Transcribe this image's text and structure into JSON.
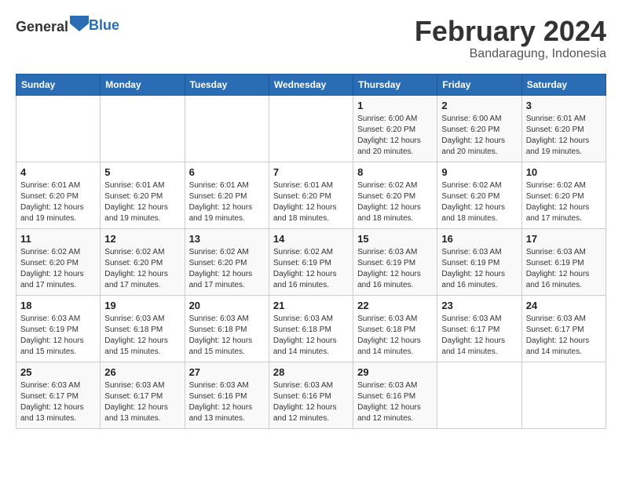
{
  "header": {
    "logo_general": "General",
    "logo_blue": "Blue",
    "month_title": "February 2024",
    "location": "Bandaragung, Indonesia"
  },
  "weekdays": [
    "Sunday",
    "Monday",
    "Tuesday",
    "Wednesday",
    "Thursday",
    "Friday",
    "Saturday"
  ],
  "weeks": [
    [
      {
        "day": "",
        "info": ""
      },
      {
        "day": "",
        "info": ""
      },
      {
        "day": "",
        "info": ""
      },
      {
        "day": "",
        "info": ""
      },
      {
        "day": "1",
        "info": "Sunrise: 6:00 AM\nSunset: 6:20 PM\nDaylight: 12 hours\nand 20 minutes."
      },
      {
        "day": "2",
        "info": "Sunrise: 6:00 AM\nSunset: 6:20 PM\nDaylight: 12 hours\nand 20 minutes."
      },
      {
        "day": "3",
        "info": "Sunrise: 6:01 AM\nSunset: 6:20 PM\nDaylight: 12 hours\nand 19 minutes."
      }
    ],
    [
      {
        "day": "4",
        "info": "Sunrise: 6:01 AM\nSunset: 6:20 PM\nDaylight: 12 hours\nand 19 minutes."
      },
      {
        "day": "5",
        "info": "Sunrise: 6:01 AM\nSunset: 6:20 PM\nDaylight: 12 hours\nand 19 minutes."
      },
      {
        "day": "6",
        "info": "Sunrise: 6:01 AM\nSunset: 6:20 PM\nDaylight: 12 hours\nand 19 minutes."
      },
      {
        "day": "7",
        "info": "Sunrise: 6:01 AM\nSunset: 6:20 PM\nDaylight: 12 hours\nand 18 minutes."
      },
      {
        "day": "8",
        "info": "Sunrise: 6:02 AM\nSunset: 6:20 PM\nDaylight: 12 hours\nand 18 minutes."
      },
      {
        "day": "9",
        "info": "Sunrise: 6:02 AM\nSunset: 6:20 PM\nDaylight: 12 hours\nand 18 minutes."
      },
      {
        "day": "10",
        "info": "Sunrise: 6:02 AM\nSunset: 6:20 PM\nDaylight: 12 hours\nand 17 minutes."
      }
    ],
    [
      {
        "day": "11",
        "info": "Sunrise: 6:02 AM\nSunset: 6:20 PM\nDaylight: 12 hours\nand 17 minutes."
      },
      {
        "day": "12",
        "info": "Sunrise: 6:02 AM\nSunset: 6:20 PM\nDaylight: 12 hours\nand 17 minutes."
      },
      {
        "day": "13",
        "info": "Sunrise: 6:02 AM\nSunset: 6:20 PM\nDaylight: 12 hours\nand 17 minutes."
      },
      {
        "day": "14",
        "info": "Sunrise: 6:02 AM\nSunset: 6:19 PM\nDaylight: 12 hours\nand 16 minutes."
      },
      {
        "day": "15",
        "info": "Sunrise: 6:03 AM\nSunset: 6:19 PM\nDaylight: 12 hours\nand 16 minutes."
      },
      {
        "day": "16",
        "info": "Sunrise: 6:03 AM\nSunset: 6:19 PM\nDaylight: 12 hours\nand 16 minutes."
      },
      {
        "day": "17",
        "info": "Sunrise: 6:03 AM\nSunset: 6:19 PM\nDaylight: 12 hours\nand 16 minutes."
      }
    ],
    [
      {
        "day": "18",
        "info": "Sunrise: 6:03 AM\nSunset: 6:19 PM\nDaylight: 12 hours\nand 15 minutes."
      },
      {
        "day": "19",
        "info": "Sunrise: 6:03 AM\nSunset: 6:18 PM\nDaylight: 12 hours\nand 15 minutes."
      },
      {
        "day": "20",
        "info": "Sunrise: 6:03 AM\nSunset: 6:18 PM\nDaylight: 12 hours\nand 15 minutes."
      },
      {
        "day": "21",
        "info": "Sunrise: 6:03 AM\nSunset: 6:18 PM\nDaylight: 12 hours\nand 14 minutes."
      },
      {
        "day": "22",
        "info": "Sunrise: 6:03 AM\nSunset: 6:18 PM\nDaylight: 12 hours\nand 14 minutes."
      },
      {
        "day": "23",
        "info": "Sunrise: 6:03 AM\nSunset: 6:17 PM\nDaylight: 12 hours\nand 14 minutes."
      },
      {
        "day": "24",
        "info": "Sunrise: 6:03 AM\nSunset: 6:17 PM\nDaylight: 12 hours\nand 14 minutes."
      }
    ],
    [
      {
        "day": "25",
        "info": "Sunrise: 6:03 AM\nSunset: 6:17 PM\nDaylight: 12 hours\nand 13 minutes."
      },
      {
        "day": "26",
        "info": "Sunrise: 6:03 AM\nSunset: 6:17 PM\nDaylight: 12 hours\nand 13 minutes."
      },
      {
        "day": "27",
        "info": "Sunrise: 6:03 AM\nSunset: 6:16 PM\nDaylight: 12 hours\nand 13 minutes."
      },
      {
        "day": "28",
        "info": "Sunrise: 6:03 AM\nSunset: 6:16 PM\nDaylight: 12 hours\nand 12 minutes."
      },
      {
        "day": "29",
        "info": "Sunrise: 6:03 AM\nSunset: 6:16 PM\nDaylight: 12 hours\nand 12 minutes."
      },
      {
        "day": "",
        "info": ""
      },
      {
        "day": "",
        "info": ""
      }
    ]
  ]
}
